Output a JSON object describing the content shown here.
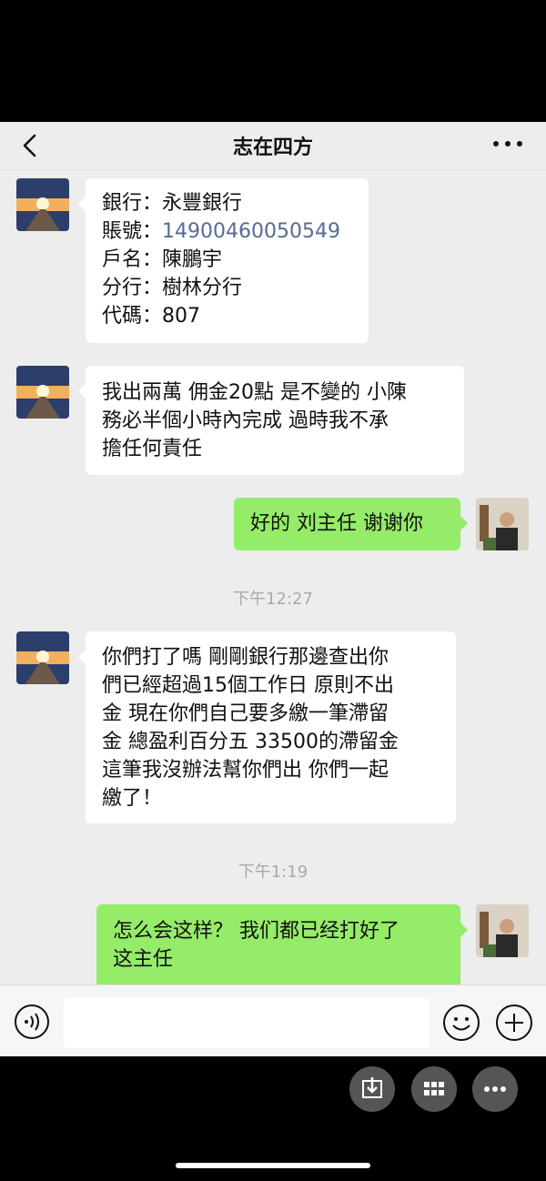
{
  "header": {
    "title": "志在四方"
  },
  "messages": [
    {
      "lines": [
        "銀行：永豐銀行",
        "賬號：",
        "戶名：陳鵬宇",
        "分行：樹林分行",
        "代碼：807"
      ],
      "account_number": "14900460050549"
    },
    {
      "lines": [
        "我出兩萬 佣金20點 是不變的 小陳",
        "務必半個小時內完成 過時我不承",
        "擔任何責任"
      ]
    },
    {
      "lines": [
        "好的 刘主任 谢谢你"
      ]
    },
    {
      "lines": [
        "你們打了嗎 剛剛銀行那邊查出你",
        "們已經超過15個工作日 原則不出",
        "金  現在你們自己要多繳一筆滯留",
        "金 總盈利百分五 33500的滯留金",
        "這筆我沒辦法幫你們出 你們一起",
        "繳了！"
      ]
    },
    {
      "lines": [
        "怎么会这样？ 我们都已经打好了",
        "这主任"
      ]
    }
  ],
  "timestamps": [
    "下午12:27",
    "下午1:19"
  ],
  "icons": {
    "back": "chevron-left-icon",
    "more": "more-icon",
    "voice": "voice-icon",
    "emoji": "emoji-icon",
    "plus": "plus-icon",
    "save": "download-icon",
    "apps": "grid-icon",
    "overflow": "more-icon"
  },
  "colors": {
    "outgoing_bubble": "#95ec69",
    "incoming_bubble": "#ffffff",
    "link": "#576b95"
  }
}
